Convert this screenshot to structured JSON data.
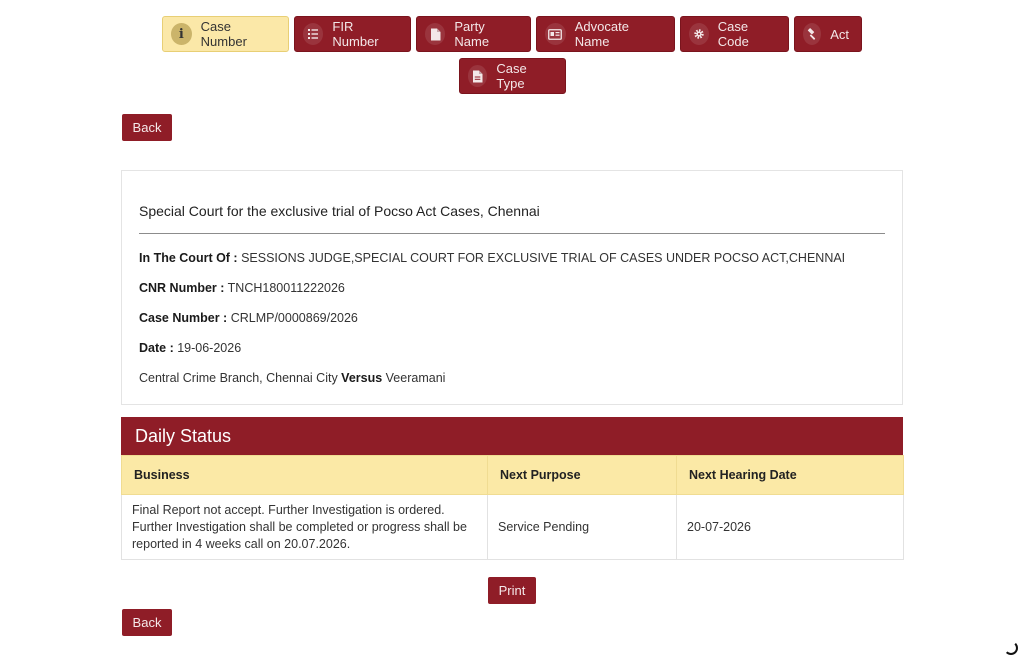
{
  "tabs": [
    {
      "label": "Case Number",
      "icon": "info-icon",
      "active": true
    },
    {
      "label": "FIR Number",
      "icon": "list-icon",
      "active": false
    },
    {
      "label": "Party Name",
      "icon": "document-icon",
      "active": false
    },
    {
      "label": "Advocate Name",
      "icon": "id-card-icon",
      "active": false
    },
    {
      "label": "Case Code",
      "icon": "gear-icon",
      "active": false
    },
    {
      "label": "Act",
      "icon": "gavel-icon",
      "active": false
    },
    {
      "label": "Case Type",
      "icon": "document-icon",
      "active": false
    }
  ],
  "buttons": {
    "back": "Back",
    "print": "Print"
  },
  "case": {
    "court_title": "Special Court for the exclusive trial of Pocso Act Cases, Chennai",
    "court_of_label": "In The Court Of :",
    "court_of_value": " SESSIONS JUDGE,SPECIAL COURT FOR EXCLUSIVE TRIAL OF CASES UNDER POCSO ACT,CHENNAI",
    "cnr_label": "CNR Number :",
    "cnr_value": " TNCH180011222026",
    "case_number_label": "Case Number :",
    "case_number_value": " CRLMP/0000869/2026",
    "date_label": "Date :",
    "date_value": " 19-06-2026",
    "petitioner": "Central Crime Branch, Chennai City ",
    "versus": "Versus",
    "respondent": " Veeramani"
  },
  "daily_status": {
    "title": "Daily Status",
    "columns": [
      "Business",
      "Next Purpose",
      "Next Hearing Date"
    ],
    "rows": [
      {
        "business": "Final Report not accept. Further Investigation is ordered. Further Investigation shall be completed or progress shall be reported in 4 weeks call on 20.07.2026.",
        "next_purpose": "Service Pending",
        "next_hearing_date": "20-07-2026"
      }
    ]
  },
  "colors": {
    "primary": "#8f1d27",
    "active_tab": "#fbe8a8",
    "table_header": "#fbe9a6"
  }
}
